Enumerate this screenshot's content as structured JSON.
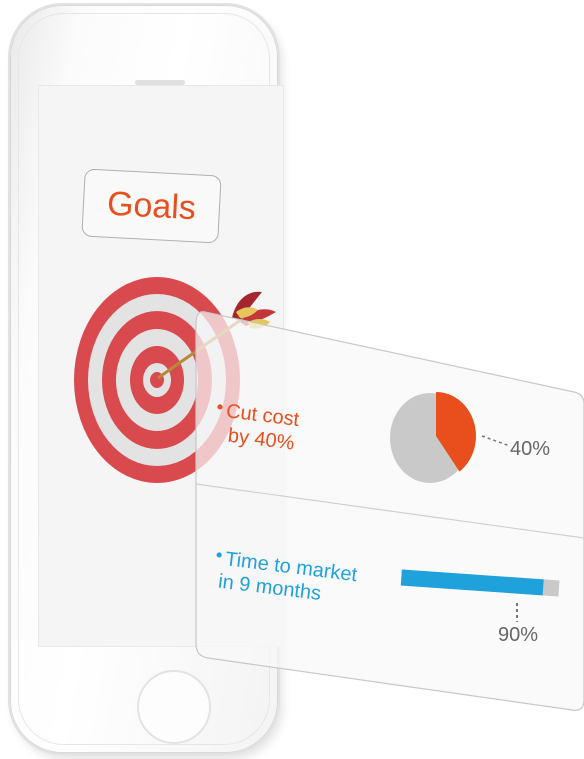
{
  "screen": {
    "title": "Goals"
  },
  "goals": [
    {
      "line1": "Cut cost",
      "line2": "by 40%",
      "value_label": "40%",
      "value": 40,
      "color": "#e84f1c"
    },
    {
      "line1": "Time to market",
      "line2": "in 9 months",
      "value_label": "90%",
      "value": 90,
      "color": "#1fa2dc"
    }
  ],
  "icons": [
    "target-icon",
    "arrow-icon",
    "pie-chart-icon",
    "progress-bar-icon"
  ],
  "colors": {
    "accent_orange": "#e84f1c",
    "accent_blue": "#1fa2dc",
    "target_red": "#d94a4f",
    "remainder_gray": "#c9c9c9"
  }
}
